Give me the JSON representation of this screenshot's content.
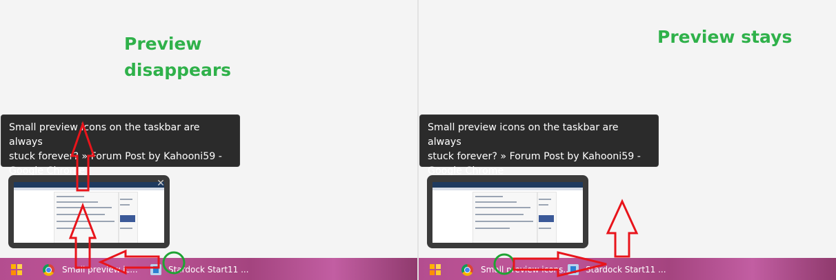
{
  "panels": {
    "left": {
      "caption_line1": "Preview",
      "caption_line2": "disappears",
      "tooltip": {
        "line1": "Small preview icons on the taskbar are always",
        "line2": "stuck forever? » Forum Post by Kahooni59 -",
        "line3": "Google Chrome"
      },
      "taskbar": {
        "chrome_label": "Small preview ic...",
        "stardock_label": "Stardock Start11 ..."
      }
    },
    "right": {
      "caption": "Preview stays",
      "tooltip": {
        "line1": "Small preview icons on the taskbar are always",
        "line2": "stuck forever? » Forum Post by Kahooni59 -",
        "line3": "Google Chrome"
      },
      "taskbar": {
        "chrome_label": "Small preview icons...",
        "stardock_label": "Stardock Start11 ..."
      }
    }
  },
  "icons": {
    "start": "start-menu-icon",
    "chrome": "chrome-icon",
    "stardock": "stardock-start11-icon",
    "close": "close-icon"
  },
  "colors": {
    "caption": "#2fb14a",
    "annotation_arrow": "#e8141b",
    "annotation_circle": "#1fa334",
    "tooltip_bg": "#2b2b2b",
    "taskbar": "#b44d8f"
  }
}
